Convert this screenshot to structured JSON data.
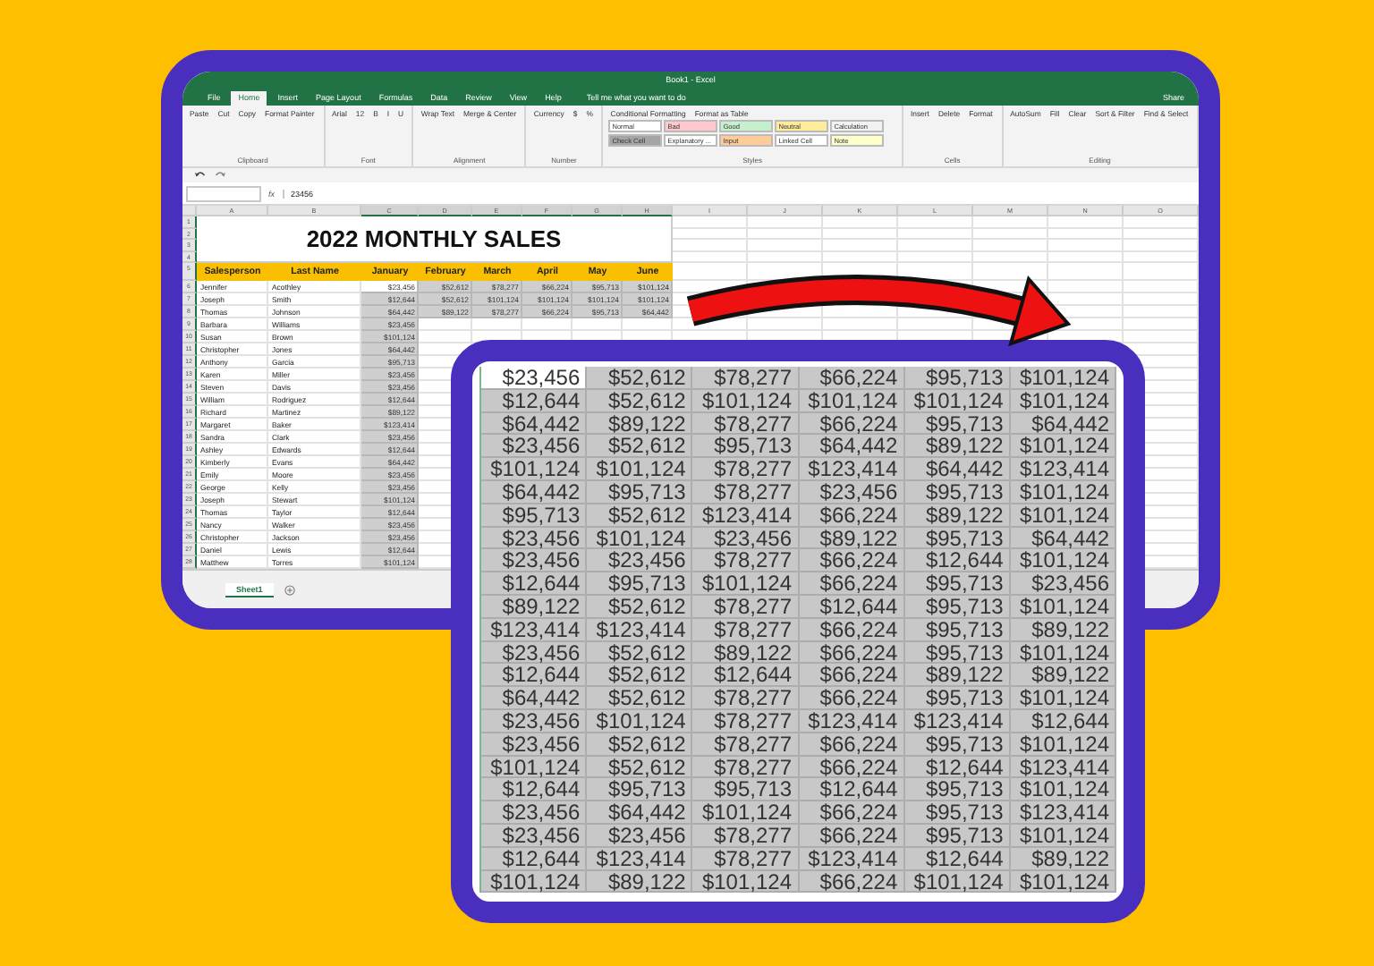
{
  "excel": {
    "title": "Book1 - Excel",
    "tabs": [
      {
        "label": "File",
        "selected": false
      },
      {
        "label": "Home",
        "selected": true
      },
      {
        "label": "Insert",
        "selected": false
      },
      {
        "label": "Page Layout",
        "selected": false
      },
      {
        "label": "Formulas",
        "selected": false
      },
      {
        "label": "Data",
        "selected": false
      },
      {
        "label": "Review",
        "selected": false
      },
      {
        "label": "View",
        "selected": false
      },
      {
        "label": "Help",
        "selected": false
      }
    ],
    "tell_me": "Tell me what you want to do",
    "share": "Share",
    "ribbon": [
      {
        "label": "Clipboard",
        "items": [
          "Paste",
          "Cut",
          "Copy",
          "Format Painter"
        ]
      },
      {
        "label": "Font",
        "items": [
          "Arial",
          "12",
          "B",
          "I",
          "U"
        ]
      },
      {
        "label": "Alignment",
        "items": [
          "Wrap Text",
          "Merge & Center"
        ]
      },
      {
        "label": "Number",
        "items": [
          "Currency",
          "$",
          "%"
        ]
      },
      {
        "label": "Styles",
        "items": [
          "Conditional Formatting",
          "Format as Table"
        ],
        "styles": [
          {
            "label": "Normal",
            "color": "#ffffff"
          },
          {
            "label": "Bad",
            "color": "#ffc7ce"
          },
          {
            "label": "Good",
            "color": "#c6efce"
          },
          {
            "label": "Neutral",
            "color": "#ffeb9c"
          },
          {
            "label": "Calculation",
            "color": "#f2f2f2"
          },
          {
            "label": "Check Cell",
            "color": "#a5a5a5"
          },
          {
            "label": "Explanatory ...",
            "color": "#ffffff"
          },
          {
            "label": "Input",
            "color": "#ffcc99"
          },
          {
            "label": "Linked Cell",
            "color": "#ffffff"
          },
          {
            "label": "Note",
            "color": "#ffffcc"
          }
        ]
      },
      {
        "label": "Cells",
        "items": [
          "Insert",
          "Delete",
          "Format"
        ]
      },
      {
        "label": "Editing",
        "items": [
          "AutoSum",
          "Fill",
          "Clear",
          "Sort & Filter",
          "Find & Select"
        ]
      }
    ],
    "formula": {
      "fx": "fx",
      "value": "23456"
    },
    "sheet": {
      "columns": [
        "A",
        "B",
        "C",
        "D",
        "E",
        "F",
        "G",
        "H",
        "I",
        "J",
        "K",
        "L",
        "M",
        "N",
        "O"
      ],
      "row_numbers": [
        "1",
        "2",
        "3",
        "4",
        "5",
        "6",
        "7",
        "8",
        "9",
        "10",
        "11",
        "12",
        "13",
        "14",
        "15",
        "16",
        "17",
        "18",
        "19",
        "20",
        "21",
        "22",
        "23",
        "24",
        "25",
        "26",
        "27",
        "28"
      ],
      "title": "2022 MONTHLY SALES",
      "headers": [
        "Salesperson",
        "Last Name",
        "January",
        "February",
        "March",
        "April",
        "May",
        "June"
      ],
      "rows": [
        {
          "first": "Jennifer",
          "last": "Acothley",
          "values": [
            {
              "value": "$23,456",
              "selected": true
            },
            {
              "value": "$52,612",
              "selected": false
            },
            {
              "value": "$78,277",
              "selected": false
            },
            {
              "value": "$66,224",
              "selected": false
            },
            {
              "value": "$95,713",
              "selected": false
            },
            {
              "value": "$101,124",
              "selected": false
            }
          ]
        },
        {
          "first": "Joseph",
          "last": "Smith",
          "values": [
            {
              "value": "$12,644",
              "selected": false
            },
            {
              "value": "$52,612",
              "selected": false
            },
            {
              "value": "$101,124",
              "selected": false
            },
            {
              "value": "$101,124",
              "selected": false
            },
            {
              "value": "$101,124",
              "selected": false
            },
            {
              "value": "$101,124",
              "selected": false
            }
          ]
        },
        {
          "first": "Thomas",
          "last": "Johnson",
          "values": [
            {
              "value": "$64,442",
              "selected": false
            },
            {
              "value": "$89,122",
              "selected": false
            },
            {
              "value": "$78,277",
              "selected": false
            },
            {
              "value": "$66,224",
              "selected": false
            },
            {
              "value": "$95,713",
              "selected": false
            },
            {
              "value": "$64,442",
              "selected": false
            }
          ]
        },
        {
          "first": "Barbara",
          "last": "Williams",
          "values": [
            {
              "value": "$23,456",
              "selected": false
            }
          ]
        },
        {
          "first": "Susan",
          "last": "Brown",
          "values": [
            {
              "value": "$101,124",
              "selected": false
            }
          ]
        },
        {
          "first": "Christopher",
          "last": "Jones",
          "values": [
            {
              "value": "$64,442",
              "selected": false
            }
          ]
        },
        {
          "first": "Anthony",
          "last": "Garcia",
          "values": [
            {
              "value": "$95,713",
              "selected": false
            }
          ]
        },
        {
          "first": "Karen",
          "last": "Miller",
          "values": [
            {
              "value": "$23,456",
              "selected": false
            }
          ]
        },
        {
          "first": "Steven",
          "last": "Davis",
          "values": [
            {
              "value": "$23,456",
              "selected": false
            }
          ]
        },
        {
          "first": "William",
          "last": "Rodriguez",
          "values": [
            {
              "value": "$12,644",
              "selected": false
            }
          ]
        },
        {
          "first": "Richard",
          "last": "Martinez",
          "values": [
            {
              "value": "$89,122",
              "selected": false
            }
          ]
        },
        {
          "first": "Margaret",
          "last": "Baker",
          "values": [
            {
              "value": "$123,414",
              "selected": false
            }
          ]
        },
        {
          "first": "Sandra",
          "last": "Clark",
          "values": [
            {
              "value": "$23,456",
              "selected": false
            }
          ]
        },
        {
          "first": "Ashley",
          "last": "Edwards",
          "values": [
            {
              "value": "$12,644",
              "selected": false
            }
          ]
        },
        {
          "first": "Kimberly",
          "last": "Evans",
          "values": [
            {
              "value": "$64,442",
              "selected": false
            }
          ]
        },
        {
          "first": "Emily",
          "last": "Moore",
          "values": [
            {
              "value": "$23,456",
              "selected": false
            }
          ]
        },
        {
          "first": "George",
          "last": "Kelly",
          "values": [
            {
              "value": "$23,456",
              "selected": false
            }
          ]
        },
        {
          "first": "Joseph",
          "last": "Stewart",
          "values": [
            {
              "value": "$101,124",
              "selected": false
            }
          ]
        },
        {
          "first": "Thomas",
          "last": "Taylor",
          "values": [
            {
              "value": "$12,644",
              "selected": false
            }
          ]
        },
        {
          "first": "Nancy",
          "last": "Walker",
          "values": [
            {
              "value": "$23,456",
              "selected": false
            }
          ]
        },
        {
          "first": "Christopher",
          "last": "Jackson",
          "values": [
            {
              "value": "$23,456",
              "selected": false
            }
          ]
        },
        {
          "first": "Daniel",
          "last": "Lewis",
          "values": [
            {
              "value": "$12,644",
              "selected": false
            }
          ]
        },
        {
          "first": "Matthew",
          "last": "Torres",
          "values": [
            {
              "value": "$101,124",
              "selected": false
            }
          ]
        }
      ]
    },
    "sheet_tabs": [
      {
        "label": "Sheet1",
        "selected": true
      }
    ]
  },
  "zoom_table": {
    "rows": [
      [
        {
          "value": "$23,456",
          "selected": true
        },
        {
          "value": "$52,612",
          "selected": false
        },
        {
          "value": "$78,277",
          "selected": false
        },
        {
          "value": "$66,224",
          "selected": false
        },
        {
          "value": "$95,713",
          "selected": false
        },
        {
          "value": "$101,124",
          "selected": false
        }
      ],
      [
        {
          "value": "$12,644",
          "selected": false
        },
        {
          "value": "$52,612",
          "selected": false
        },
        {
          "value": "$101,124",
          "selected": false
        },
        {
          "value": "$101,124",
          "selected": false
        },
        {
          "value": "$101,124",
          "selected": false
        },
        {
          "value": "$101,124",
          "selected": false
        }
      ],
      [
        {
          "value": "$64,442",
          "selected": false
        },
        {
          "value": "$89,122",
          "selected": false
        },
        {
          "value": "$78,277",
          "selected": false
        },
        {
          "value": "$66,224",
          "selected": false
        },
        {
          "value": "$95,713",
          "selected": false
        },
        {
          "value": "$64,442",
          "selected": false
        }
      ],
      [
        {
          "value": "$23,456",
          "selected": false
        },
        {
          "value": "$52,612",
          "selected": false
        },
        {
          "value": "$95,713",
          "selected": false
        },
        {
          "value": "$64,442",
          "selected": false
        },
        {
          "value": "$89,122",
          "selected": false
        },
        {
          "value": "$101,124",
          "selected": false
        }
      ],
      [
        {
          "value": "$101,124",
          "selected": false
        },
        {
          "value": "$101,124",
          "selected": false
        },
        {
          "value": "$78,277",
          "selected": false
        },
        {
          "value": "$123,414",
          "selected": false
        },
        {
          "value": "$64,442",
          "selected": false
        },
        {
          "value": "$123,414",
          "selected": false
        }
      ],
      [
        {
          "value": "$64,442",
          "selected": false
        },
        {
          "value": "$95,713",
          "selected": false
        },
        {
          "value": "$78,277",
          "selected": false
        },
        {
          "value": "$23,456",
          "selected": false
        },
        {
          "value": "$95,713",
          "selected": false
        },
        {
          "value": "$101,124",
          "selected": false
        }
      ],
      [
        {
          "value": "$95,713",
          "selected": false
        },
        {
          "value": "$52,612",
          "selected": false
        },
        {
          "value": "$123,414",
          "selected": false
        },
        {
          "value": "$66,224",
          "selected": false
        },
        {
          "value": "$89,122",
          "selected": false
        },
        {
          "value": "$101,124",
          "selected": false
        }
      ],
      [
        {
          "value": "$23,456",
          "selected": false
        },
        {
          "value": "$101,124",
          "selected": false
        },
        {
          "value": "$23,456",
          "selected": false
        },
        {
          "value": "$89,122",
          "selected": false
        },
        {
          "value": "$95,713",
          "selected": false
        },
        {
          "value": "$64,442",
          "selected": false
        }
      ],
      [
        {
          "value": "$23,456",
          "selected": false
        },
        {
          "value": "$23,456",
          "selected": false
        },
        {
          "value": "$78,277",
          "selected": false
        },
        {
          "value": "$66,224",
          "selected": false
        },
        {
          "value": "$12,644",
          "selected": false
        },
        {
          "value": "$101,124",
          "selected": false
        }
      ],
      [
        {
          "value": "$12,644",
          "selected": false
        },
        {
          "value": "$95,713",
          "selected": false
        },
        {
          "value": "$101,124",
          "selected": false
        },
        {
          "value": "$66,224",
          "selected": false
        },
        {
          "value": "$95,713",
          "selected": false
        },
        {
          "value": "$23,456",
          "selected": false
        }
      ],
      [
        {
          "value": "$89,122",
          "selected": false
        },
        {
          "value": "$52,612",
          "selected": false
        },
        {
          "value": "$78,277",
          "selected": false
        },
        {
          "value": "$12,644",
          "selected": false
        },
        {
          "value": "$95,713",
          "selected": false
        },
        {
          "value": "$101,124",
          "selected": false
        }
      ],
      [
        {
          "value": "$123,414",
          "selected": false
        },
        {
          "value": "$123,414",
          "selected": false
        },
        {
          "value": "$78,277",
          "selected": false
        },
        {
          "value": "$66,224",
          "selected": false
        },
        {
          "value": "$95,713",
          "selected": false
        },
        {
          "value": "$89,122",
          "selected": false
        }
      ],
      [
        {
          "value": "$23,456",
          "selected": false
        },
        {
          "value": "$52,612",
          "selected": false
        },
        {
          "value": "$89,122",
          "selected": false
        },
        {
          "value": "$66,224",
          "selected": false
        },
        {
          "value": "$95,713",
          "selected": false
        },
        {
          "value": "$101,124",
          "selected": false
        }
      ],
      [
        {
          "value": "$12,644",
          "selected": false
        },
        {
          "value": "$52,612",
          "selected": false
        },
        {
          "value": "$12,644",
          "selected": false
        },
        {
          "value": "$66,224",
          "selected": false
        },
        {
          "value": "$89,122",
          "selected": false
        },
        {
          "value": "$89,122",
          "selected": false
        }
      ],
      [
        {
          "value": "$64,442",
          "selected": false
        },
        {
          "value": "$52,612",
          "selected": false
        },
        {
          "value": "$78,277",
          "selected": false
        },
        {
          "value": "$66,224",
          "selected": false
        },
        {
          "value": "$95,713",
          "selected": false
        },
        {
          "value": "$101,124",
          "selected": false
        }
      ],
      [
        {
          "value": "$23,456",
          "selected": false
        },
        {
          "value": "$101,124",
          "selected": false
        },
        {
          "value": "$78,277",
          "selected": false
        },
        {
          "value": "$123,414",
          "selected": false
        },
        {
          "value": "$123,414",
          "selected": false
        },
        {
          "value": "$12,644",
          "selected": false
        }
      ],
      [
        {
          "value": "$23,456",
          "selected": false
        },
        {
          "value": "$52,612",
          "selected": false
        },
        {
          "value": "$78,277",
          "selected": false
        },
        {
          "value": "$66,224",
          "selected": false
        },
        {
          "value": "$95,713",
          "selected": false
        },
        {
          "value": "$101,124",
          "selected": false
        }
      ],
      [
        {
          "value": "$101,124",
          "selected": false
        },
        {
          "value": "$52,612",
          "selected": false
        },
        {
          "value": "$78,277",
          "selected": false
        },
        {
          "value": "$66,224",
          "selected": false
        },
        {
          "value": "$12,644",
          "selected": false
        },
        {
          "value": "$123,414",
          "selected": false
        }
      ],
      [
        {
          "value": "$12,644",
          "selected": false
        },
        {
          "value": "$95,713",
          "selected": false
        },
        {
          "value": "$95,713",
          "selected": false
        },
        {
          "value": "$12,644",
          "selected": false
        },
        {
          "value": "$95,713",
          "selected": false
        },
        {
          "value": "$101,124",
          "selected": false
        }
      ],
      [
        {
          "value": "$23,456",
          "selected": false
        },
        {
          "value": "$64,442",
          "selected": false
        },
        {
          "value": "$101,124",
          "selected": false
        },
        {
          "value": "$66,224",
          "selected": false
        },
        {
          "value": "$95,713",
          "selected": false
        },
        {
          "value": "$123,414",
          "selected": false
        }
      ],
      [
        {
          "value": "$23,456",
          "selected": false
        },
        {
          "value": "$23,456",
          "selected": false
        },
        {
          "value": "$78,277",
          "selected": false
        },
        {
          "value": "$66,224",
          "selected": false
        },
        {
          "value": "$95,713",
          "selected": false
        },
        {
          "value": "$101,124",
          "selected": false
        }
      ],
      [
        {
          "value": "$12,644",
          "selected": false
        },
        {
          "value": "$123,414",
          "selected": false
        },
        {
          "value": "$78,277",
          "selected": false
        },
        {
          "value": "$123,414",
          "selected": false
        },
        {
          "value": "$12,644",
          "selected": false
        },
        {
          "value": "$89,122",
          "selected": false
        }
      ],
      [
        {
          "value": "$101,124",
          "selected": false
        },
        {
          "value": "$89,122",
          "selected": false
        },
        {
          "value": "$101,124",
          "selected": false
        },
        {
          "value": "$66,224",
          "selected": false
        },
        {
          "value": "$101,124",
          "selected": false
        },
        {
          "value": "$101,124",
          "selected": false
        }
      ]
    ]
  }
}
